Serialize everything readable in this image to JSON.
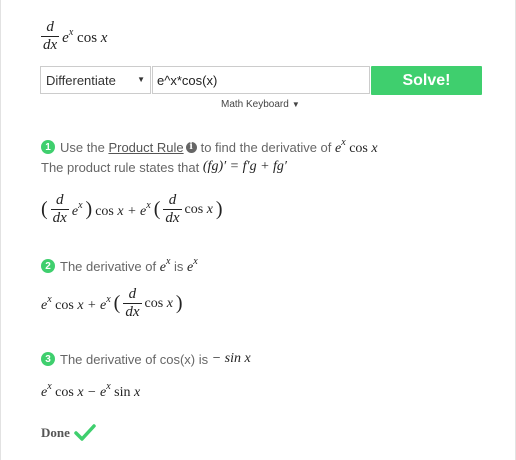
{
  "problem": {
    "operator_num": "d",
    "operator_den": "dx",
    "expression": "e",
    "expression_sup": "x",
    "expression_tail": "cos x"
  },
  "controls": {
    "mode_selected": "Differentiate",
    "input_value": "e^x*cos(x)",
    "solve_label": "Solve!",
    "math_keyboard_label": "Math Keyboard"
  },
  "steps": [
    {
      "number": "1",
      "pre": "Use the",
      "link": "Product Rule",
      "post": "to find the derivative of",
      "rule_text": "The product rule states that",
      "rule_formula": "(fg)′ = f′g + fg′"
    },
    {
      "number": "2",
      "pre": "The derivative of",
      "post": "is"
    },
    {
      "number": "3",
      "pre": "The derivative of cos(x) is",
      "result": "− sin x"
    }
  ],
  "done_label": "Done",
  "accent_color": "#3fcf6e"
}
